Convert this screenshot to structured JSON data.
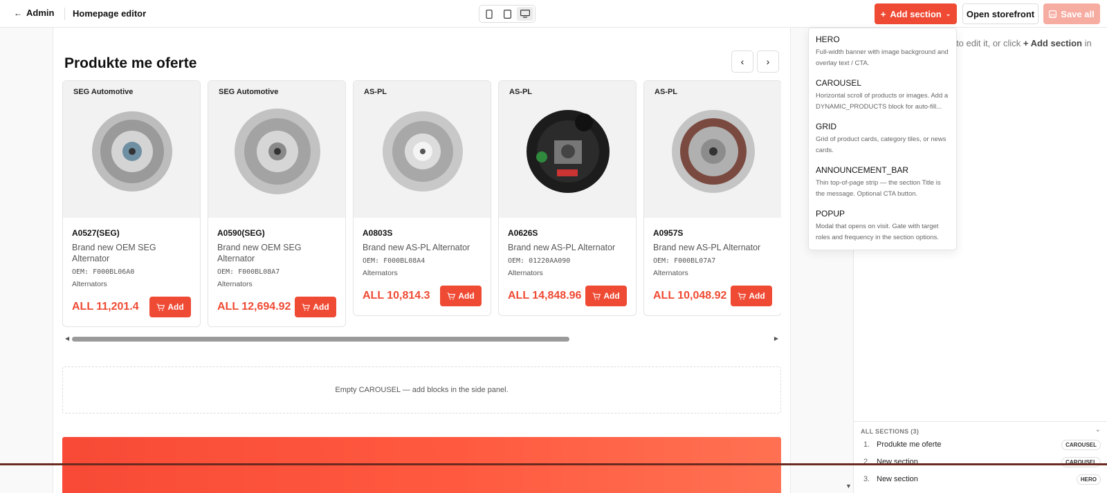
{
  "topbar": {
    "back_label": "Admin",
    "title": "Homepage editor",
    "add_section_label": "Add section",
    "open_storefront_label": "Open storefront",
    "save_all_label": "Save all"
  },
  "carousel": {
    "title": "Produkte me oferte",
    "products": [
      {
        "brand": "SEG Automotive",
        "code": "A0527(SEG)",
        "name": "Brand new OEM SEG Alternator",
        "oem": "OEM: F000BL06A0",
        "category": "Alternators",
        "price": "ALL 11,201.4",
        "add_label": "Add"
      },
      {
        "brand": "SEG Automotive",
        "code": "A0590(SEG)",
        "name": "Brand new OEM SEG Alternator",
        "oem": "OEM: F000BL08A7",
        "category": "Alternators",
        "price": "ALL 12,694.92",
        "add_label": "Add"
      },
      {
        "brand": "AS-PL",
        "code": "A0803S",
        "name": "Brand new AS-PL Alternator",
        "oem": "OEM: F000BL08A4",
        "category": "Alternators",
        "price": "ALL 10,814.3",
        "add_label": "Add"
      },
      {
        "brand": "AS-PL",
        "code": "A0626S",
        "name": "Brand new AS-PL Alternator",
        "oem": "OEM: 01220AA090",
        "category": "Alternators",
        "price": "ALL 14,848.96",
        "add_label": "Add"
      },
      {
        "brand": "AS-PL",
        "code": "A0957S",
        "name": "Brand new AS-PL Alternator",
        "oem": "OEM: F000BL07A7",
        "category": "Alternators",
        "price": "ALL 10,048.92",
        "add_label": "Add"
      }
    ]
  },
  "empty_carousel_text": "Empty CAROUSEL — add blocks in the side panel.",
  "right_panel": {
    "hint_part1": "eft to edit it, or click ",
    "hint_bold": "+ Add section",
    "hint_part2": " in"
  },
  "dropdown": {
    "items": [
      {
        "title": "HERO",
        "desc": "Full-width banner with image background and overlay text / CTA."
      },
      {
        "title": "CAROUSEL",
        "desc": "Horizontal scroll of products or images. Add a DYNAMIC_PRODUCTS block for auto-fill..."
      },
      {
        "title": "GRID",
        "desc": "Grid of product cards, category tiles, or news cards."
      },
      {
        "title": "ANNOUNCEMENT_BAR",
        "desc": "Thin top-of-page strip — the section Title is the message. Optional CTA button."
      },
      {
        "title": "POPUP",
        "desc": "Modal that opens on visit. Gate with target roles and frequency in the section options."
      }
    ]
  },
  "sections_panel": {
    "header": "ALL SECTIONS (3)",
    "rows": [
      {
        "num": "1.",
        "label": "Produkte me oferte",
        "tag": "CAROUSEL"
      },
      {
        "num": "2.",
        "label": "New section",
        "tag": "CAROUSEL"
      },
      {
        "num": "3.",
        "label": "New section",
        "tag": "HERO"
      }
    ]
  },
  "colors": {
    "accent": "#ef4a33",
    "save_disabled": "#f7aca2"
  }
}
